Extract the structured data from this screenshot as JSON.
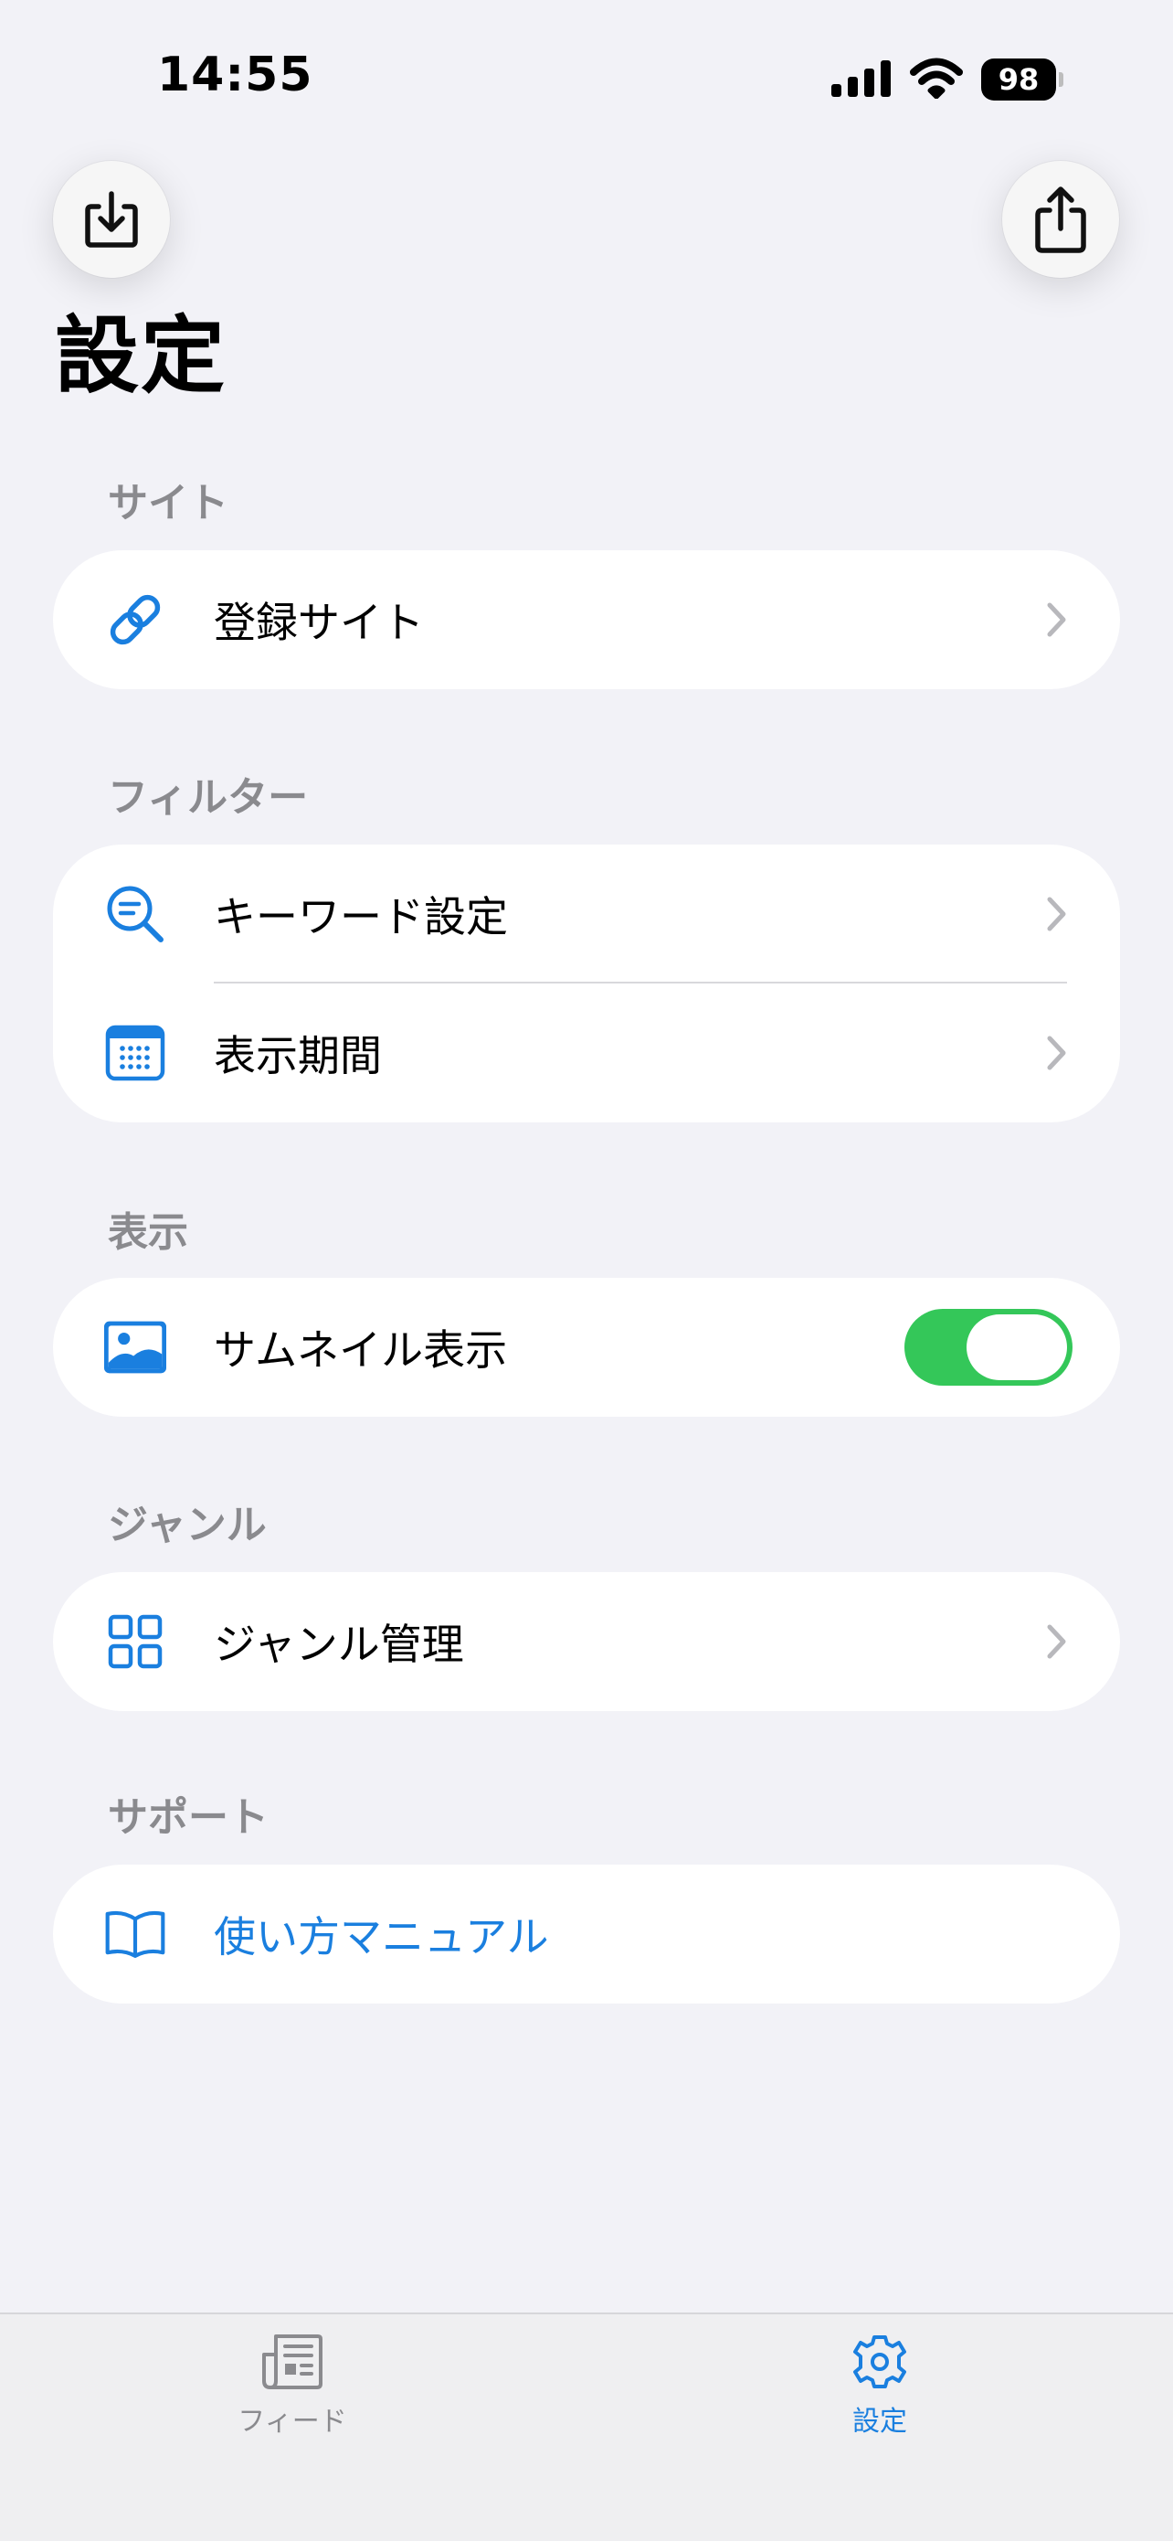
{
  "status_bar": {
    "time": "14:55",
    "battery_level": "98"
  },
  "nav": {
    "title": "設定"
  },
  "sections": {
    "site": {
      "header": "サイト",
      "registered_sites": "登録サイト"
    },
    "filter": {
      "header": "フィルター",
      "keyword_settings": "キーワード設定",
      "display_period": "表示期間"
    },
    "display": {
      "header": "表示",
      "thumbnail_display": "サムネイル表示",
      "thumbnail_enabled": true
    },
    "genre": {
      "header": "ジャンル",
      "genre_management": "ジャンル管理"
    },
    "support": {
      "header": "サポート",
      "manual": "使い方マニュアル"
    }
  },
  "tab_bar": {
    "feed_label": "フィード",
    "settings_label": "設定",
    "selected": "settings"
  },
  "colors": {
    "accent": "#1A7FDF",
    "toggle_on": "#34C759",
    "background": "#F2F2F7",
    "secondary_text": "#8A8A8E"
  },
  "icons": {
    "import": "tray-arrow-down-icon",
    "share": "share-icon",
    "site": "link-icon",
    "keyword": "text-magnifier-icon",
    "period": "calendar-icon",
    "thumbnail": "photo-icon",
    "genre": "grid-icon",
    "manual": "book-icon",
    "feed_tab": "newspaper-icon",
    "settings_tab": "gear-icon"
  }
}
